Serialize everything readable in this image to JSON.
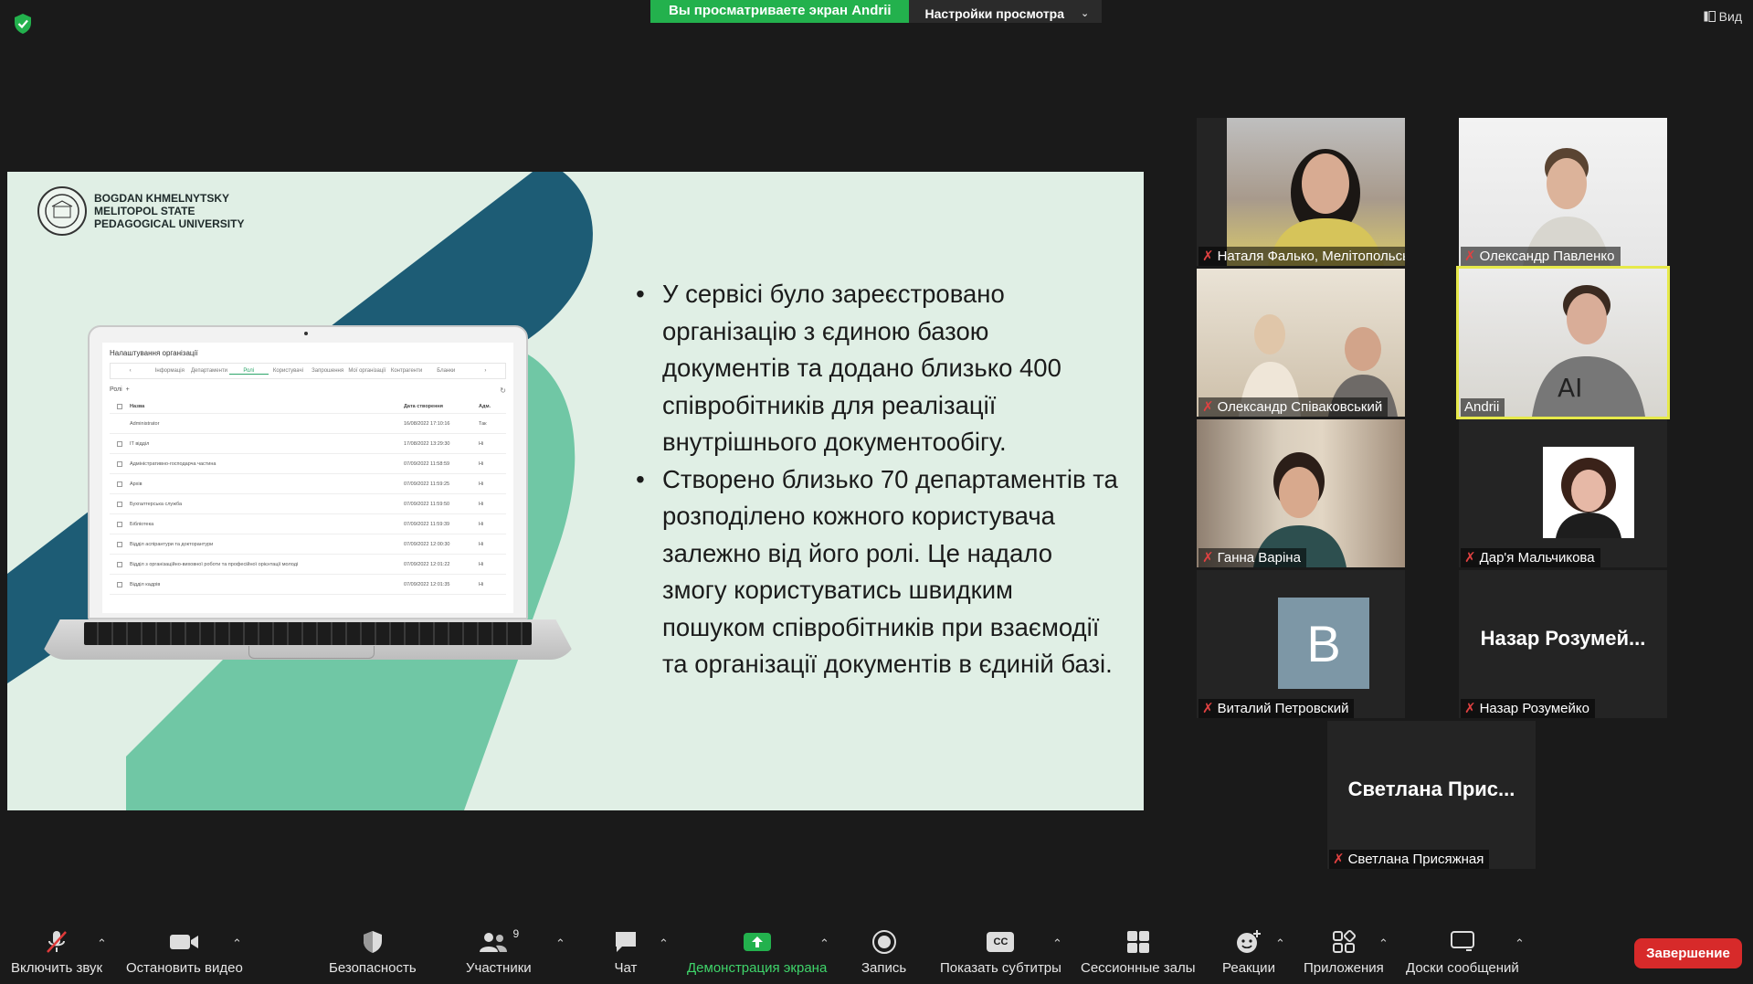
{
  "banner": {
    "sharing": "Вы просматриваете экран Andrii",
    "view_options": "Настройки просмотра"
  },
  "top_right": {
    "view": "Вид"
  },
  "slide": {
    "university": [
      "BOGDAN KHMELNYTSKY",
      "MELITOPOL STATE",
      "PEDAGOGICAL UNIVERSITY"
    ],
    "bullets": [
      "У сервісі було зареєстровано організацію з єдиною базою документів та додано близько 400 співробітників для реалізації внутрішнього документообігу.",
      "Створено близько 70 департаментів та розподілено кожного користувача залежно від його ролі. Це надало змогу користуватись швидким пошуком співробітників при взаємодії та організації документів в єдиній базі."
    ],
    "laptop": {
      "title": "Налаштування організації",
      "tabs": [
        "Інформація",
        "Департаменти",
        "Ролі",
        "Користувачі",
        "Запрошення",
        "Мої організації",
        "Контрагенти",
        "Бланки"
      ],
      "active_tab": "Ролі",
      "roles_label": "Ролі",
      "columns": [
        "Назва",
        "Дата створення",
        "Адм."
      ],
      "rows": [
        [
          "Administrator",
          "16/08/2022 17:10:16",
          "Так"
        ],
        [
          "IT відділ",
          "17/08/2022 13:29:30",
          "Ні"
        ],
        [
          "Адміністративно-господарча частина",
          "07/09/2022 11:58:59",
          "Ні"
        ],
        [
          "Архів",
          "07/09/2022 11:59:25",
          "Ні"
        ],
        [
          "Бухгалтерська служба",
          "07/09/2022 11:59:50",
          "Ні"
        ],
        [
          "Бібліотека",
          "07/09/2022 11:59:39",
          "Ні"
        ],
        [
          "Відділ аспірантури та докторантури",
          "07/09/2022 12:00:30",
          "Ні"
        ],
        [
          "Відділ з організаційно-виховної роботи та професійної орієнтації молоді",
          "07/09/2022 12:01:22",
          "Ні"
        ],
        [
          "Відділ кадрів",
          "07/09/2022 12:01:35",
          "Ні"
        ]
      ]
    }
  },
  "participants": [
    {
      "name": "Наталя Фалько, Мелітопольський..."
    },
    {
      "name": "Олександр Павленко"
    },
    {
      "name": "Олександр Співаковський"
    },
    {
      "name": "Andrii"
    },
    {
      "name": "Ганна Варіна"
    },
    {
      "name": "Дар'я Мальчикова"
    },
    {
      "name": "Виталий Петровский",
      "avatar_letter": "B"
    },
    {
      "name": "Назар Розумейко",
      "display": "Назар  Розумей..."
    },
    {
      "name": "Светлана Присяжная",
      "display": "Светлана  Прис..."
    }
  ],
  "toolbar": {
    "unmute": "Включить звук",
    "stop_video": "Остановить видео",
    "security": "Безопасность",
    "participants": "Участники",
    "participants_count": "9",
    "chat": "Чат",
    "share": "Демонстрация экрана",
    "record": "Запись",
    "captions": "Показать субтитры",
    "captions_icon": "CC",
    "breakout": "Сессионные залы",
    "reactions": "Реакции",
    "apps": "Приложения",
    "whiteboards": "Доски сообщений",
    "end": "Завершение"
  },
  "colors": {
    "share_green": "#23b14d",
    "end_red": "#d72a2a",
    "active_speaker": "#e6e94a",
    "slide_bg": "#e0efe5",
    "dark_teal": "#1d5c75",
    "mint": "#5cc09a"
  }
}
